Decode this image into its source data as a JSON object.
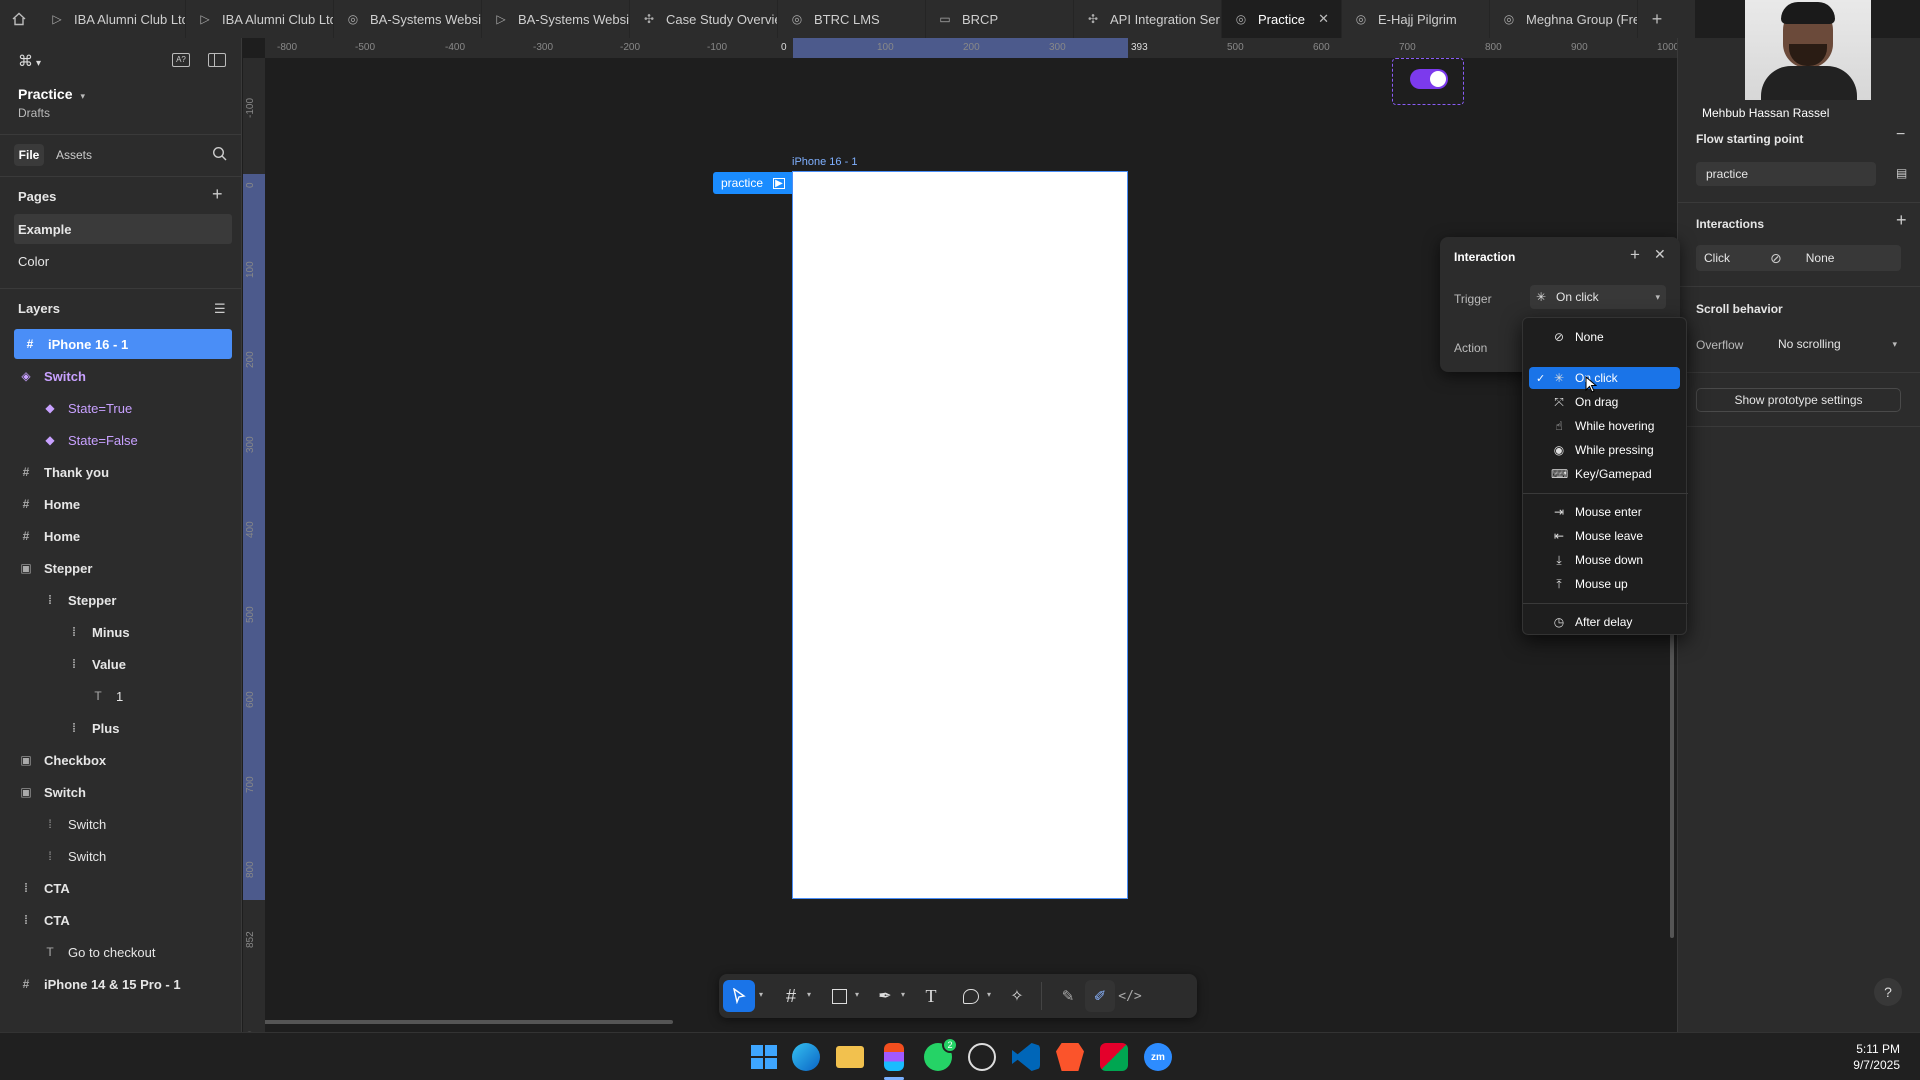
{
  "tabs": [
    {
      "label": "IBA Alumni Club Ltd",
      "icon": "play-icon"
    },
    {
      "label": "IBA Alumni Club Ltd",
      "icon": "play-icon"
    },
    {
      "label": "BA-Systems Website",
      "icon": "prototype-icon"
    },
    {
      "label": "BA-Systems Website",
      "icon": "play-icon"
    },
    {
      "label": "Case Study Overview",
      "icon": "component-icon"
    },
    {
      "label": "BTRC LMS",
      "icon": "prototype-icon"
    },
    {
      "label": "BRCP",
      "icon": "book-icon"
    },
    {
      "label": "API Integration Ser",
      "icon": "component-icon"
    },
    {
      "label": "Practice",
      "icon": "prototype-icon",
      "active": true
    },
    {
      "label": "E-Hajj Pilgrim",
      "icon": "prototype-icon"
    },
    {
      "label": "Meghna Group (Fre",
      "icon": "prototype-icon"
    }
  ],
  "file": {
    "name": "Practice",
    "location": "Drafts"
  },
  "left_tabs": {
    "file": "File",
    "assets": "Assets"
  },
  "pages": {
    "title": "Pages",
    "items": [
      "Example",
      "Color"
    ]
  },
  "layers": {
    "title": "Layers",
    "items": [
      {
        "label": "iPhone 16 - 1",
        "glyph": "#",
        "indent": 0,
        "selected": true,
        "bold": true
      },
      {
        "label": "Switch",
        "glyph": "◈",
        "indent": 0,
        "component": true,
        "bold": true
      },
      {
        "label": "State=True",
        "glyph": "◆",
        "indent": 1,
        "component": true
      },
      {
        "label": "State=False",
        "glyph": "◆",
        "indent": 1,
        "component": true
      },
      {
        "label": "Thank you",
        "glyph": "#",
        "indent": 0,
        "bold": true
      },
      {
        "label": "Home",
        "glyph": "#",
        "indent": 0,
        "bold": true
      },
      {
        "label": "Home",
        "glyph": "#",
        "indent": 0,
        "bold": true
      },
      {
        "label": "Stepper",
        "glyph": "▣",
        "indent": 0,
        "bold": true
      },
      {
        "label": "Stepper",
        "glyph": "⁞",
        "indent": 1,
        "bold": true
      },
      {
        "label": "Minus",
        "glyph": "⁞",
        "indent": 2,
        "bold": true
      },
      {
        "label": "Value",
        "glyph": "⁞",
        "indent": 2,
        "bold": true
      },
      {
        "label": "1",
        "glyph": "T",
        "indent": 3
      },
      {
        "label": "Plus",
        "glyph": "⁞",
        "indent": 2,
        "bold": true
      },
      {
        "label": "Checkbox",
        "glyph": "▣",
        "indent": 0,
        "bold": true
      },
      {
        "label": "Switch",
        "glyph": "▣",
        "indent": 0,
        "bold": true
      },
      {
        "label": "Switch",
        "glyph": "⁞",
        "indent": 1
      },
      {
        "label": "Switch",
        "glyph": "⁞",
        "indent": 1
      },
      {
        "label": "CTA",
        "glyph": "⁞",
        "indent": 0,
        "bold": true
      },
      {
        "label": "CTA",
        "glyph": "⁞",
        "indent": 0,
        "bold": true
      },
      {
        "label": "Go to checkout",
        "glyph": "T",
        "indent": 1
      },
      {
        "label": "iPhone 14 & 15 Pro - 1",
        "glyph": "#",
        "indent": 0,
        "bold": true
      }
    ]
  },
  "ruler": {
    "top": [
      "-800",
      "-500",
      "-400",
      "-300",
      "-200",
      "-100",
      "0",
      "100",
      "200",
      "300",
      "393",
      "500",
      "600",
      "700",
      "800",
      "900",
      "1000"
    ],
    "left": [
      "-100",
      "0",
      "100",
      "200",
      "300",
      "400",
      "500",
      "600",
      "700",
      "800",
      "852",
      "900"
    ]
  },
  "canvas": {
    "frame_label": "iPhone 16 - 1",
    "flow_badge": "practice"
  },
  "interaction": {
    "title": "Interaction",
    "trigger_label": "Trigger",
    "trigger_value": "On click",
    "action_label": "Action"
  },
  "trigger_menu": [
    {
      "label": "None",
      "icon": "none-icon",
      "glyph": "⊘",
      "group": 0
    },
    {
      "label": "On click",
      "icon": "click-icon",
      "glyph": "✳",
      "group": 1,
      "selected": true
    },
    {
      "label": "On drag",
      "icon": "drag-icon",
      "glyph": "⤧",
      "group": 1
    },
    {
      "label": "While hovering",
      "icon": "hover-icon",
      "glyph": "☝",
      "group": 1
    },
    {
      "label": "While pressing",
      "icon": "press-icon",
      "glyph": "◉",
      "group": 1
    },
    {
      "label": "Key/Gamepad",
      "icon": "keyboard-icon",
      "glyph": "⌨",
      "group": 1
    },
    {
      "label": "Mouse enter",
      "icon": "mouse-enter-icon",
      "glyph": "⇥",
      "group": 2
    },
    {
      "label": "Mouse leave",
      "icon": "mouse-leave-icon",
      "glyph": "⇤",
      "group": 2
    },
    {
      "label": "Mouse down",
      "icon": "mouse-down-icon",
      "glyph": "⤓",
      "group": 2
    },
    {
      "label": "Mouse up",
      "icon": "mouse-up-icon",
      "glyph": "⤒",
      "group": 2
    },
    {
      "label": "After delay",
      "icon": "delay-icon",
      "glyph": "◷",
      "group": 3
    }
  ],
  "right_panel": {
    "user_name": "Mehbub Hassan Rassel",
    "flow_title": "Flow starting point",
    "flow_value": "practice",
    "interactions_title": "Interactions",
    "interaction_trigger": "Click",
    "interaction_action": "None",
    "scroll_title": "Scroll behavior",
    "overflow_label": "Overflow",
    "overflow_value": "No scrolling",
    "prototype_button": "Show prototype settings"
  },
  "taskbar": {
    "time": "5:11 PM",
    "date": "9/7/2025",
    "whatsapp_badge": "2"
  },
  "colors": {
    "accent": "#4a8ef7",
    "menu_selected": "#1a74e8",
    "toggle": "#7c3aed",
    "component": "#c8a1ff"
  }
}
